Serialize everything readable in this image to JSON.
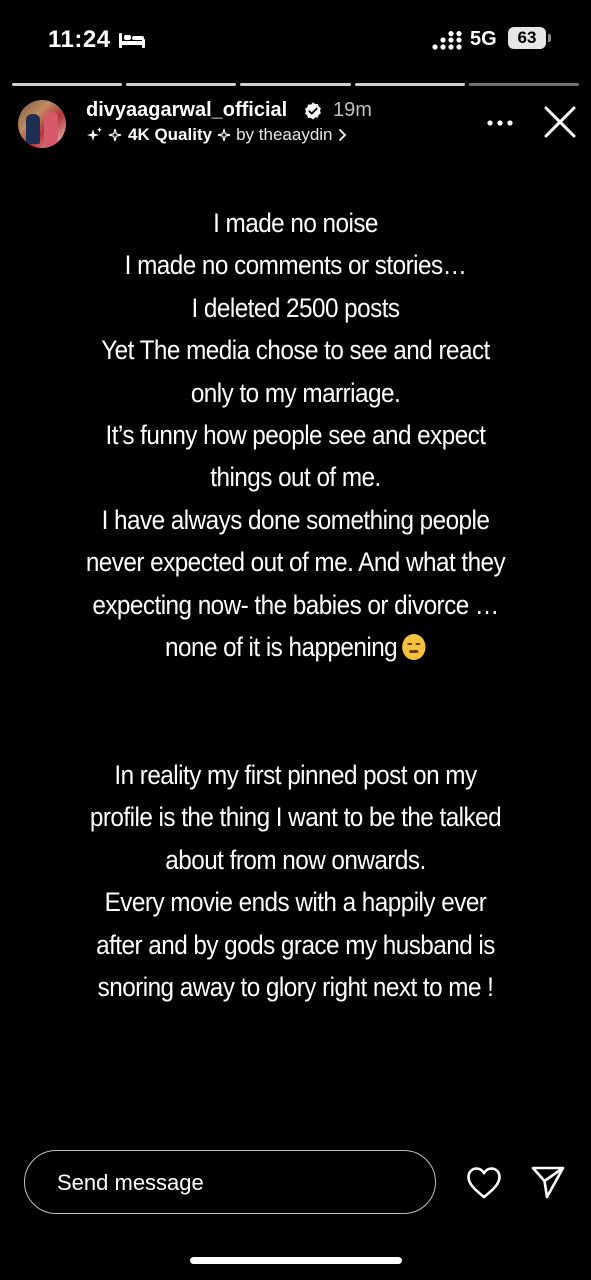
{
  "status_bar": {
    "time": "11:24",
    "network": "5G",
    "battery": "63",
    "icons": [
      "bed-icon",
      "signal-icon"
    ]
  },
  "story": {
    "progress": {
      "segments": 5,
      "completed": 4
    },
    "header": {
      "username": "divyaagarwal_official",
      "time_ago": "19m",
      "music_title": "4K Quality",
      "music_artist": "by theaaydin",
      "icons": [
        "verified-icon",
        "sparkle-icon",
        "more-icon",
        "close-icon"
      ]
    },
    "paragraph_1": [
      "I made no noise",
      "I made no comments or stories…",
      "I deleted 2500 posts",
      "Yet The media chose to see and react",
      "only to my marriage.",
      "It’s funny how people see and expect",
      "things out of me.",
      "I have always done something people",
      "never expected out of me. And what they",
      "expecting now- the babies or divorce …",
      "none of it is happening"
    ],
    "paragraph_2": [
      "In reality my first pinned post on my",
      "profile is the thing I want to be the talked",
      "about from now onwards.",
      "Every movie ends with a happily ever",
      "after and by gods grace my husband is",
      "snoring away to glory right next to me !"
    ]
  },
  "reply": {
    "placeholder": "Send message",
    "icons": [
      "heart-icon",
      "send-icon"
    ]
  },
  "colors": {
    "background": "#000000",
    "text": "#ffffff",
    "battery": "#e6e6e6"
  }
}
